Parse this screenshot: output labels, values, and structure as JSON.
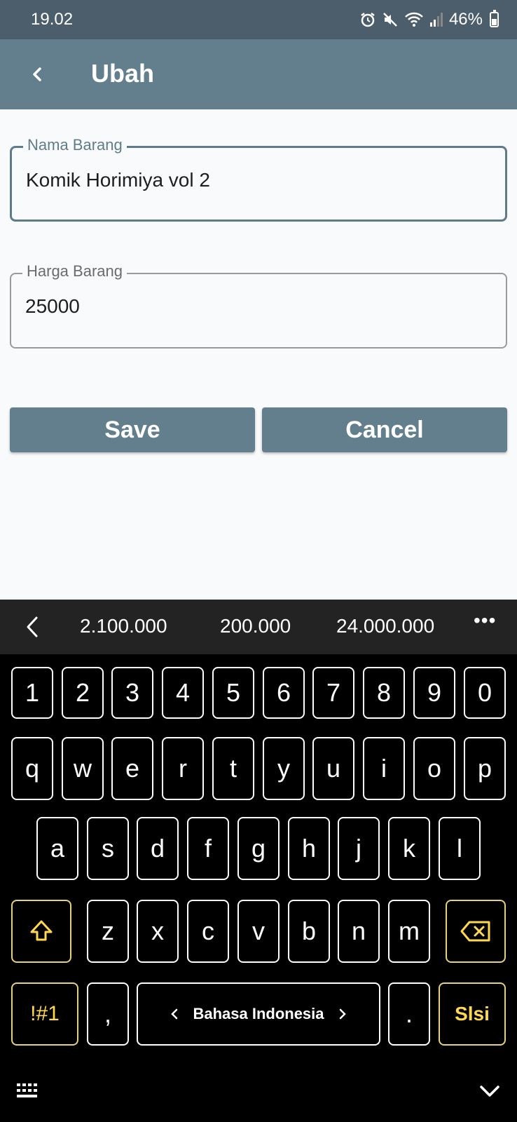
{
  "status_bar": {
    "time": "19.02",
    "battery": "46%",
    "icons": [
      "alarm-icon",
      "mute-icon",
      "wifi-icon",
      "signal-icon",
      "battery-icon"
    ]
  },
  "app_bar": {
    "title": "Ubah",
    "back_icon": "back-arrow-icon"
  },
  "form": {
    "nama": {
      "label": "Nama Barang",
      "value": "Komik Horimiya vol 2"
    },
    "harga": {
      "label": "Harga Barang",
      "value": "25000"
    }
  },
  "buttons": {
    "save": "Save",
    "cancel": "Cancel"
  },
  "suggestions": {
    "items": [
      "2.100.000",
      "200.000",
      "24.000.000"
    ],
    "more": "•••"
  },
  "keyboard": {
    "numbers": [
      "1",
      "2",
      "3",
      "4",
      "5",
      "6",
      "7",
      "8",
      "9",
      "0"
    ],
    "row1": [
      "q",
      "w",
      "e",
      "r",
      "t",
      "y",
      "u",
      "i",
      "o",
      "p"
    ],
    "row2": [
      "a",
      "s",
      "d",
      "f",
      "g",
      "h",
      "j",
      "k",
      "l"
    ],
    "row3": [
      "z",
      "x",
      "c",
      "v",
      "b",
      "n",
      "m"
    ],
    "symbols": "!#1",
    "comma": ",",
    "language": "Bahasa Indonesia",
    "period": ".",
    "action": "Slsi"
  },
  "colors": {
    "status_bar": "#4c5e6b",
    "app_bar": "#637f8e",
    "button": "#637f8e",
    "accent_key": "#ffd84d"
  }
}
